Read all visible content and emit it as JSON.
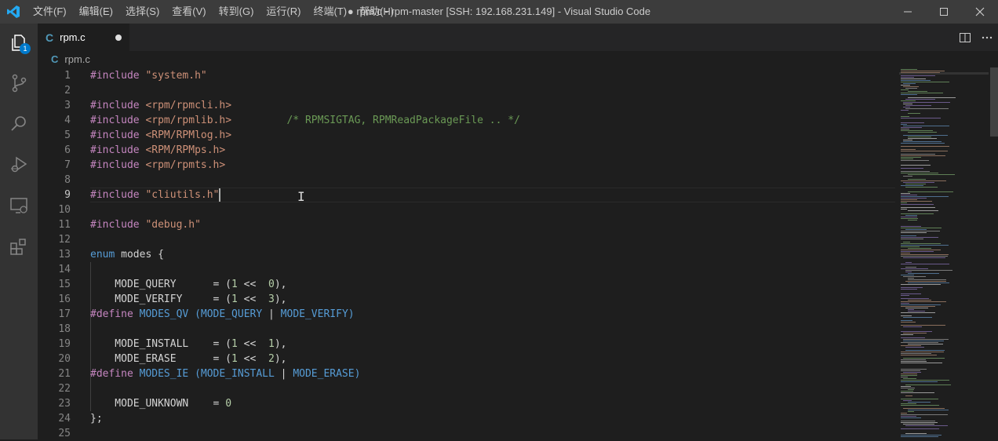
{
  "window": {
    "title": "● rpm.c - rpm-master [SSH: 192.168.231.149] - Visual Studio Code"
  },
  "menu": [
    {
      "label": "文件(F)",
      "name": "menu-file"
    },
    {
      "label": "编辑(E)",
      "name": "menu-edit"
    },
    {
      "label": "选择(S)",
      "name": "menu-selection"
    },
    {
      "label": "查看(V)",
      "name": "menu-view"
    },
    {
      "label": "转到(G)",
      "name": "menu-go"
    },
    {
      "label": "运行(R)",
      "name": "menu-run"
    },
    {
      "label": "终端(T)",
      "name": "menu-terminal"
    },
    {
      "label": "帮助(H)",
      "name": "menu-help"
    }
  ],
  "activity_bar": {
    "items": [
      {
        "name": "explorer-icon",
        "badge": "1"
      },
      {
        "name": "source-control-icon"
      },
      {
        "name": "search-icon"
      },
      {
        "name": "run-debug-icon"
      },
      {
        "name": "remote-explorer-icon"
      },
      {
        "name": "extensions-icon"
      }
    ]
  },
  "tab": {
    "icon_glyph": "C",
    "label": "rpm.c",
    "dirty": true
  },
  "breadcrumb": {
    "icon_glyph": "C",
    "label": "rpm.c"
  },
  "editor": {
    "active_line": 9,
    "colors": {
      "keyword": "#c586c0",
      "string": "#ce9178",
      "comment": "#6a9955",
      "macro": "#569cd6",
      "macro_ref": "#4fc1ff",
      "text": "#d4d4d4",
      "number": "#b5cea8"
    },
    "lines": [
      {
        "n": 1,
        "tokens": [
          [
            "#include",
            "keyword"
          ],
          [
            " ",
            "text"
          ],
          [
            "\"system.h\"",
            "string"
          ]
        ]
      },
      {
        "n": 2,
        "tokens": []
      },
      {
        "n": 3,
        "tokens": [
          [
            "#include",
            "keyword"
          ],
          [
            " ",
            "text"
          ],
          [
            "<rpm/rpmcli.h>",
            "string"
          ]
        ]
      },
      {
        "n": 4,
        "tokens": [
          [
            "#include",
            "keyword"
          ],
          [
            " ",
            "text"
          ],
          [
            "<rpm/rpmlib.h>",
            "string"
          ],
          [
            "         ",
            "text"
          ],
          [
            "/* RPMSIGTAG, RPMReadPackageFile .. */",
            "comment"
          ]
        ]
      },
      {
        "n": 5,
        "tokens": [
          [
            "#include",
            "keyword"
          ],
          [
            " ",
            "text"
          ],
          [
            "<RPM/RPMlog.h>",
            "string"
          ]
        ]
      },
      {
        "n": 6,
        "tokens": [
          [
            "#include",
            "keyword"
          ],
          [
            " ",
            "text"
          ],
          [
            "<RPM/RPMps.h>",
            "string"
          ]
        ]
      },
      {
        "n": 7,
        "tokens": [
          [
            "#include",
            "keyword"
          ],
          [
            " ",
            "text"
          ],
          [
            "<rpm/rpmts.h>",
            "string"
          ]
        ]
      },
      {
        "n": 8,
        "tokens": []
      },
      {
        "n": 9,
        "tokens": [
          [
            "#include",
            "keyword"
          ],
          [
            " ",
            "text"
          ],
          [
            "\"cliutils.h\"",
            "string"
          ]
        ]
      },
      {
        "n": 10,
        "tokens": []
      },
      {
        "n": 11,
        "tokens": [
          [
            "#include",
            "keyword"
          ],
          [
            " ",
            "text"
          ],
          [
            "\"debug.h\"",
            "string"
          ]
        ]
      },
      {
        "n": 12,
        "tokens": []
      },
      {
        "n": 13,
        "tokens": [
          [
            "enum",
            "macro"
          ],
          [
            " modes {",
            "text"
          ]
        ]
      },
      {
        "n": 14,
        "tokens": []
      },
      {
        "n": 15,
        "tokens": [
          [
            "    MODE_QUERY      = (",
            "text"
          ],
          [
            "1",
            "number"
          ],
          [
            " <<  ",
            "text"
          ],
          [
            "0",
            "number"
          ],
          [
            "),",
            "text"
          ]
        ]
      },
      {
        "n": 16,
        "tokens": [
          [
            "    MODE_VERIFY     = (",
            "text"
          ],
          [
            "1",
            "number"
          ],
          [
            " <<  ",
            "text"
          ],
          [
            "3",
            "number"
          ],
          [
            "),",
            "text"
          ]
        ]
      },
      {
        "n": 17,
        "tokens": [
          [
            "#define",
            "keyword"
          ],
          [
            " ",
            "text"
          ],
          [
            "MODES_QV",
            "macro"
          ],
          [
            " (",
            "macro"
          ],
          [
            "MODE_QUERY",
            "macro"
          ],
          [
            " | ",
            "text"
          ],
          [
            "MODE_VERIFY",
            "macro"
          ],
          [
            ")",
            "macro"
          ]
        ]
      },
      {
        "n": 18,
        "tokens": []
      },
      {
        "n": 19,
        "tokens": [
          [
            "    MODE_INSTALL    = (",
            "text"
          ],
          [
            "1",
            "number"
          ],
          [
            " <<  ",
            "text"
          ],
          [
            "1",
            "number"
          ],
          [
            "),",
            "text"
          ]
        ]
      },
      {
        "n": 20,
        "tokens": [
          [
            "    MODE_ERASE      = (",
            "text"
          ],
          [
            "1",
            "number"
          ],
          [
            " <<  ",
            "text"
          ],
          [
            "2",
            "number"
          ],
          [
            "),",
            "text"
          ]
        ]
      },
      {
        "n": 21,
        "tokens": [
          [
            "#define",
            "keyword"
          ],
          [
            " ",
            "text"
          ],
          [
            "MODES_IE",
            "macro"
          ],
          [
            " (",
            "macro"
          ],
          [
            "MODE_INSTALL",
            "macro"
          ],
          [
            " | ",
            "text"
          ],
          [
            "MODE_ERASE",
            "macro"
          ],
          [
            ")",
            "macro"
          ]
        ]
      },
      {
        "n": 22,
        "tokens": []
      },
      {
        "n": 23,
        "tokens": [
          [
            "    MODE_UNKNOWN    = ",
            "text"
          ],
          [
            "0",
            "number"
          ]
        ]
      },
      {
        "n": 24,
        "tokens": [
          [
            "};",
            "text"
          ]
        ]
      },
      {
        "n": 25,
        "tokens": []
      }
    ]
  }
}
